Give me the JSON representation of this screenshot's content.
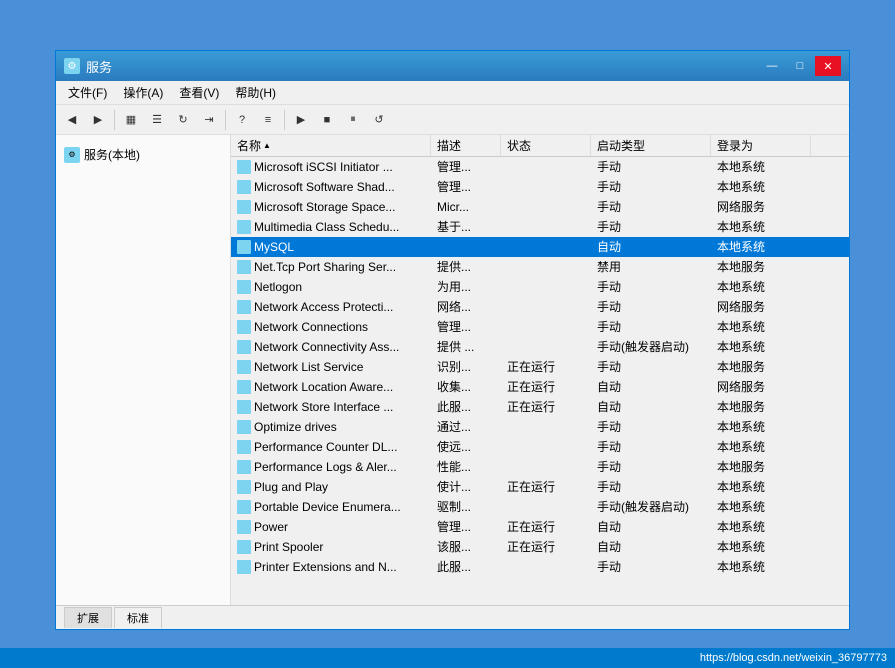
{
  "window": {
    "title": "服务",
    "controls": {
      "minimize": "—",
      "maximize": "□",
      "close": "✕"
    }
  },
  "menu": {
    "items": [
      "文件(F)",
      "操作(A)",
      "查看(V)",
      "帮助(H)"
    ]
  },
  "sidebar": {
    "label": "服务(本地)"
  },
  "columns": {
    "name": "名称",
    "description": "描述",
    "status": "状态",
    "startup": "启动类型",
    "login": "登录为"
  },
  "services": [
    {
      "name": "Microsoft iSCSI Initiator ...",
      "desc": "管理...",
      "status": "",
      "startup": "手动",
      "login": "本地系统"
    },
    {
      "name": "Microsoft Software Shad...",
      "desc": "管理...",
      "status": "",
      "startup": "手动",
      "login": "本地系统"
    },
    {
      "name": "Microsoft Storage Space...",
      "desc": "Micr...",
      "status": "",
      "startup": "手动",
      "login": "网络服务"
    },
    {
      "name": "Multimedia Class Schedu...",
      "desc": "基于...",
      "status": "",
      "startup": "手动",
      "login": "本地系统"
    },
    {
      "name": "MySQL",
      "desc": "",
      "status": "",
      "startup": "自动",
      "login": "本地系统",
      "selected": true
    },
    {
      "name": "Net.Tcp Port Sharing Ser...",
      "desc": "提供...",
      "status": "",
      "startup": "禁用",
      "login": "本地服务"
    },
    {
      "name": "Netlogon",
      "desc": "为用...",
      "status": "",
      "startup": "手动",
      "login": "本地系统"
    },
    {
      "name": "Network Access Protecti...",
      "desc": "网络...",
      "status": "",
      "startup": "手动",
      "login": "网络服务"
    },
    {
      "name": "Network Connections",
      "desc": "管理...",
      "status": "",
      "startup": "手动",
      "login": "本地系统"
    },
    {
      "name": "Network Connectivity Ass...",
      "desc": "提供 ...",
      "status": "",
      "startup": "手动(触发器启动)",
      "login": "本地系统"
    },
    {
      "name": "Network List Service",
      "desc": "识别...",
      "status": "正在运行",
      "startup": "手动",
      "login": "本地服务"
    },
    {
      "name": "Network Location Aware...",
      "desc": "收集...",
      "status": "正在运行",
      "startup": "自动",
      "login": "网络服务"
    },
    {
      "name": "Network Store Interface ...",
      "desc": "此服...",
      "status": "正在运行",
      "startup": "自动",
      "login": "本地服务"
    },
    {
      "name": "Optimize drives",
      "desc": "通过...",
      "status": "",
      "startup": "手动",
      "login": "本地系统"
    },
    {
      "name": "Performance Counter DL...",
      "desc": "使远...",
      "status": "",
      "startup": "手动",
      "login": "本地系统"
    },
    {
      "name": "Performance Logs & Aler...",
      "desc": "性能...",
      "status": "",
      "startup": "手动",
      "login": "本地服务"
    },
    {
      "name": "Plug and Play",
      "desc": "使计...",
      "status": "正在运行",
      "startup": "手动",
      "login": "本地系统"
    },
    {
      "name": "Portable Device Enumera...",
      "desc": "驱制...",
      "status": "",
      "startup": "手动(触发器启动)",
      "login": "本地系统"
    },
    {
      "name": "Power",
      "desc": "管理...",
      "status": "正在运行",
      "startup": "自动",
      "login": "本地系统"
    },
    {
      "name": "Print Spooler",
      "desc": "该服...",
      "status": "正在运行",
      "startup": "自动",
      "login": "本地系统"
    },
    {
      "name": "Printer Extensions and N...",
      "desc": "此服...",
      "status": "",
      "startup": "手动",
      "login": "本地系统"
    }
  ],
  "tabs": [
    "扩展",
    "标准"
  ],
  "status_bar": {
    "url": "https://blog.csdn.net/weixin_36797773"
  }
}
